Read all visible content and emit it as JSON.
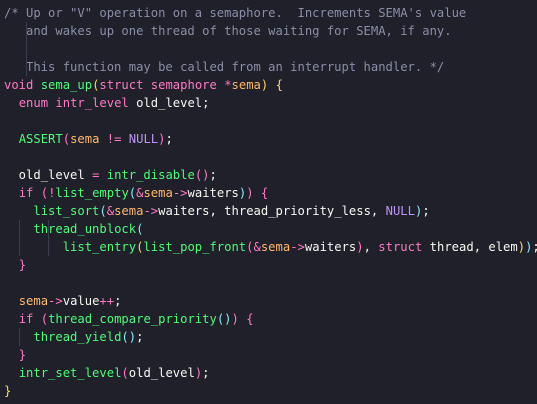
{
  "colors": {
    "background": "#1f2029",
    "comment": "#8a8ea8",
    "keyword": "#ff79c6",
    "function": "#50fa7b",
    "type": "#8be9fd",
    "parameter": "#ffb86c",
    "text": "#f8f8f2",
    "constant": "#bd93f9",
    "brace_outer": "#ffd866"
  },
  "lines": [
    [
      {
        "t": "/* Up or \"V\" operation on a semaphore.  Increments SEMA's value",
        "c": "comment"
      }
    ],
    [
      {
        "t": "   and wakes up one thread of those waiting for SEMA, if any.",
        "c": "comment"
      }
    ],
    [
      {
        "t": "",
        "c": "text"
      }
    ],
    [
      {
        "t": "   This function may be called from an interrupt handler. */",
        "c": "comment"
      }
    ],
    [
      {
        "t": "void",
        "c": "kw"
      },
      {
        "t": " ",
        "c": "text"
      },
      {
        "t": "sema_up",
        "c": "fn"
      },
      {
        "t": "(",
        "c": "brace1"
      },
      {
        "t": "struct",
        "c": "kw"
      },
      {
        "t": " ",
        "c": "text"
      },
      {
        "t": "semaphore",
        "c": "kw"
      },
      {
        "t": " ",
        "c": "text"
      },
      {
        "t": "*",
        "c": "op"
      },
      {
        "t": "sema",
        "c": "param"
      },
      {
        "t": ")",
        "c": "brace1"
      },
      {
        "t": " ",
        "c": "text"
      },
      {
        "t": "{",
        "c": "brace1"
      }
    ],
    [
      {
        "t": "  ",
        "c": "text"
      },
      {
        "t": "enum",
        "c": "kw"
      },
      {
        "t": " ",
        "c": "text"
      },
      {
        "t": "intr_level",
        "c": "kw"
      },
      {
        "t": " old_level;",
        "c": "text"
      }
    ],
    [
      {
        "t": "",
        "c": "text"
      }
    ],
    [
      {
        "t": "  ",
        "c": "text"
      },
      {
        "t": "ASSERT",
        "c": "fn"
      },
      {
        "t": "(",
        "c": "brace2"
      },
      {
        "t": "sema",
        "c": "param"
      },
      {
        "t": " ",
        "c": "text"
      },
      {
        "t": "!=",
        "c": "op"
      },
      {
        "t": " ",
        "c": "text"
      },
      {
        "t": "NULL",
        "c": "const"
      },
      {
        "t": ")",
        "c": "brace2"
      },
      {
        "t": ";",
        "c": "text"
      }
    ],
    [
      {
        "t": "",
        "c": "text"
      }
    ],
    [
      {
        "t": "  old_level ",
        "c": "text"
      },
      {
        "t": "=",
        "c": "op"
      },
      {
        "t": " ",
        "c": "text"
      },
      {
        "t": "intr_disable",
        "c": "fn"
      },
      {
        "t": "()",
        "c": "brace2"
      },
      {
        "t": ";",
        "c": "text"
      }
    ],
    [
      {
        "t": "  ",
        "c": "text"
      },
      {
        "t": "if",
        "c": "kw"
      },
      {
        "t": " ",
        "c": "text"
      },
      {
        "t": "(",
        "c": "brace2"
      },
      {
        "t": "!",
        "c": "op"
      },
      {
        "t": "list_empty",
        "c": "fn"
      },
      {
        "t": "(",
        "c": "brace3"
      },
      {
        "t": "&",
        "c": "op"
      },
      {
        "t": "sema",
        "c": "param"
      },
      {
        "t": "->",
        "c": "op"
      },
      {
        "t": "waiters",
        "c": "text"
      },
      {
        "t": ")",
        "c": "brace3"
      },
      {
        "t": ")",
        "c": "brace2"
      },
      {
        "t": " ",
        "c": "text"
      },
      {
        "t": "{",
        "c": "brace2"
      }
    ],
    [
      {
        "t": "    ",
        "c": "text"
      },
      {
        "t": "list_sort",
        "c": "fn"
      },
      {
        "t": "(",
        "c": "brace3"
      },
      {
        "t": "&",
        "c": "op"
      },
      {
        "t": "sema",
        "c": "param"
      },
      {
        "t": "->",
        "c": "op"
      },
      {
        "t": "waiters, thread_priority_less, ",
        "c": "text"
      },
      {
        "t": "NULL",
        "c": "const"
      },
      {
        "t": ")",
        "c": "brace3"
      },
      {
        "t": ";",
        "c": "text"
      }
    ],
    [
      {
        "t": "    ",
        "c": "text"
      },
      {
        "t": "thread_unblock",
        "c": "fn"
      },
      {
        "t": "(",
        "c": "brace3"
      }
    ],
    [
      {
        "t": "        ",
        "c": "text"
      },
      {
        "t": "list_entry",
        "c": "fn"
      },
      {
        "t": "(",
        "c": "brace1"
      },
      {
        "t": "list_pop_front",
        "c": "fn"
      },
      {
        "t": "(",
        "c": "brace2"
      },
      {
        "t": "&",
        "c": "op"
      },
      {
        "t": "sema",
        "c": "param"
      },
      {
        "t": "->",
        "c": "op"
      },
      {
        "t": "waiters",
        "c": "text"
      },
      {
        "t": ")",
        "c": "brace2"
      },
      {
        "t": ", ",
        "c": "text"
      },
      {
        "t": "struct",
        "c": "kw"
      },
      {
        "t": " thread, elem",
        "c": "text"
      },
      {
        "t": ")",
        "c": "brace1"
      },
      {
        "t": ")",
        "c": "brace3"
      },
      {
        "t": ";",
        "c": "text"
      }
    ],
    [
      {
        "t": "  ",
        "c": "text"
      },
      {
        "t": "}",
        "c": "brace2"
      }
    ],
    [
      {
        "t": "",
        "c": "text"
      }
    ],
    [
      {
        "t": "  ",
        "c": "text"
      },
      {
        "t": "sema",
        "c": "param"
      },
      {
        "t": "->",
        "c": "op"
      },
      {
        "t": "value",
        "c": "text"
      },
      {
        "t": "++",
        "c": "op"
      },
      {
        "t": ";",
        "c": "text"
      }
    ],
    [
      {
        "t": "  ",
        "c": "text"
      },
      {
        "t": "if",
        "c": "kw"
      },
      {
        "t": " ",
        "c": "text"
      },
      {
        "t": "(",
        "c": "brace2"
      },
      {
        "t": "thread_compare_priority",
        "c": "fn"
      },
      {
        "t": "()",
        "c": "brace3"
      },
      {
        "t": ")",
        "c": "brace2"
      },
      {
        "t": " ",
        "c": "text"
      },
      {
        "t": "{",
        "c": "brace2"
      }
    ],
    [
      {
        "t": "    ",
        "c": "text"
      },
      {
        "t": "thread_yield",
        "c": "fn"
      },
      {
        "t": "()",
        "c": "brace3"
      },
      {
        "t": ";",
        "c": "text"
      }
    ],
    [
      {
        "t": "  ",
        "c": "text"
      },
      {
        "t": "}",
        "c": "brace2"
      }
    ],
    [
      {
        "t": "  ",
        "c": "text"
      },
      {
        "t": "intr_set_level",
        "c": "fn"
      },
      {
        "t": "(",
        "c": "brace2"
      },
      {
        "t": "old_level",
        "c": "text"
      },
      {
        "t": ")",
        "c": "brace2"
      },
      {
        "t": ";",
        "c": "text"
      }
    ],
    [
      {
        "t": "}",
        "c": "brace1"
      }
    ]
  ]
}
